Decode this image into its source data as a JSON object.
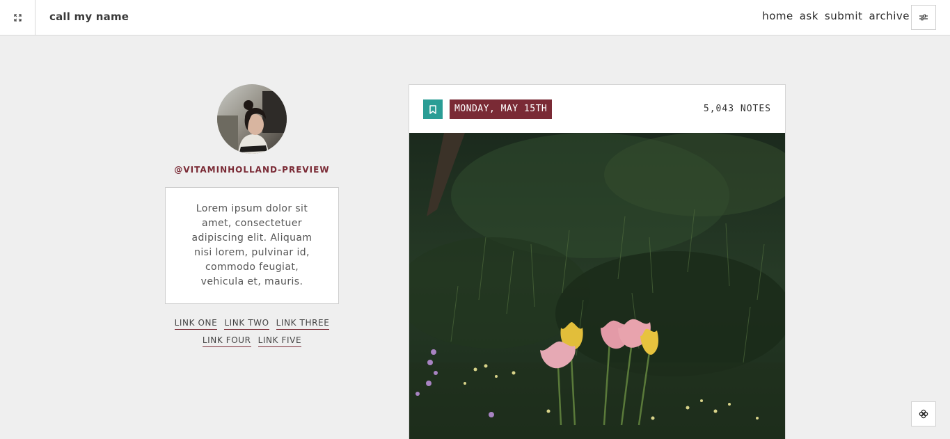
{
  "header": {
    "site_title": "call my name",
    "nav": [
      "home",
      "ask",
      "submit",
      "archive"
    ],
    "expand_icon": "expand-icon",
    "settings_icon": "sliders-icon"
  },
  "sidebar": {
    "username": "@VITAMINHOLLAND-PREVIEW",
    "description": "Lorem ipsum dolor sit amet, consectetuer adipiscing elit. Aliquam nisi lorem, pulvinar id, commodo feugiat, vehicula et, mauris.",
    "links": [
      "LINK ONE",
      "LINK TWO",
      "LINK THREE",
      "LINK FOUR",
      "LINK FIVE"
    ]
  },
  "post": {
    "date": "MONDAY, MAY 15TH",
    "notes": "5,043 NOTES",
    "bookmark_icon": "bookmark-icon"
  },
  "colors": {
    "accent_maroon": "#7a2a35",
    "accent_teal": "#2a9d95",
    "background": "#efefef"
  }
}
